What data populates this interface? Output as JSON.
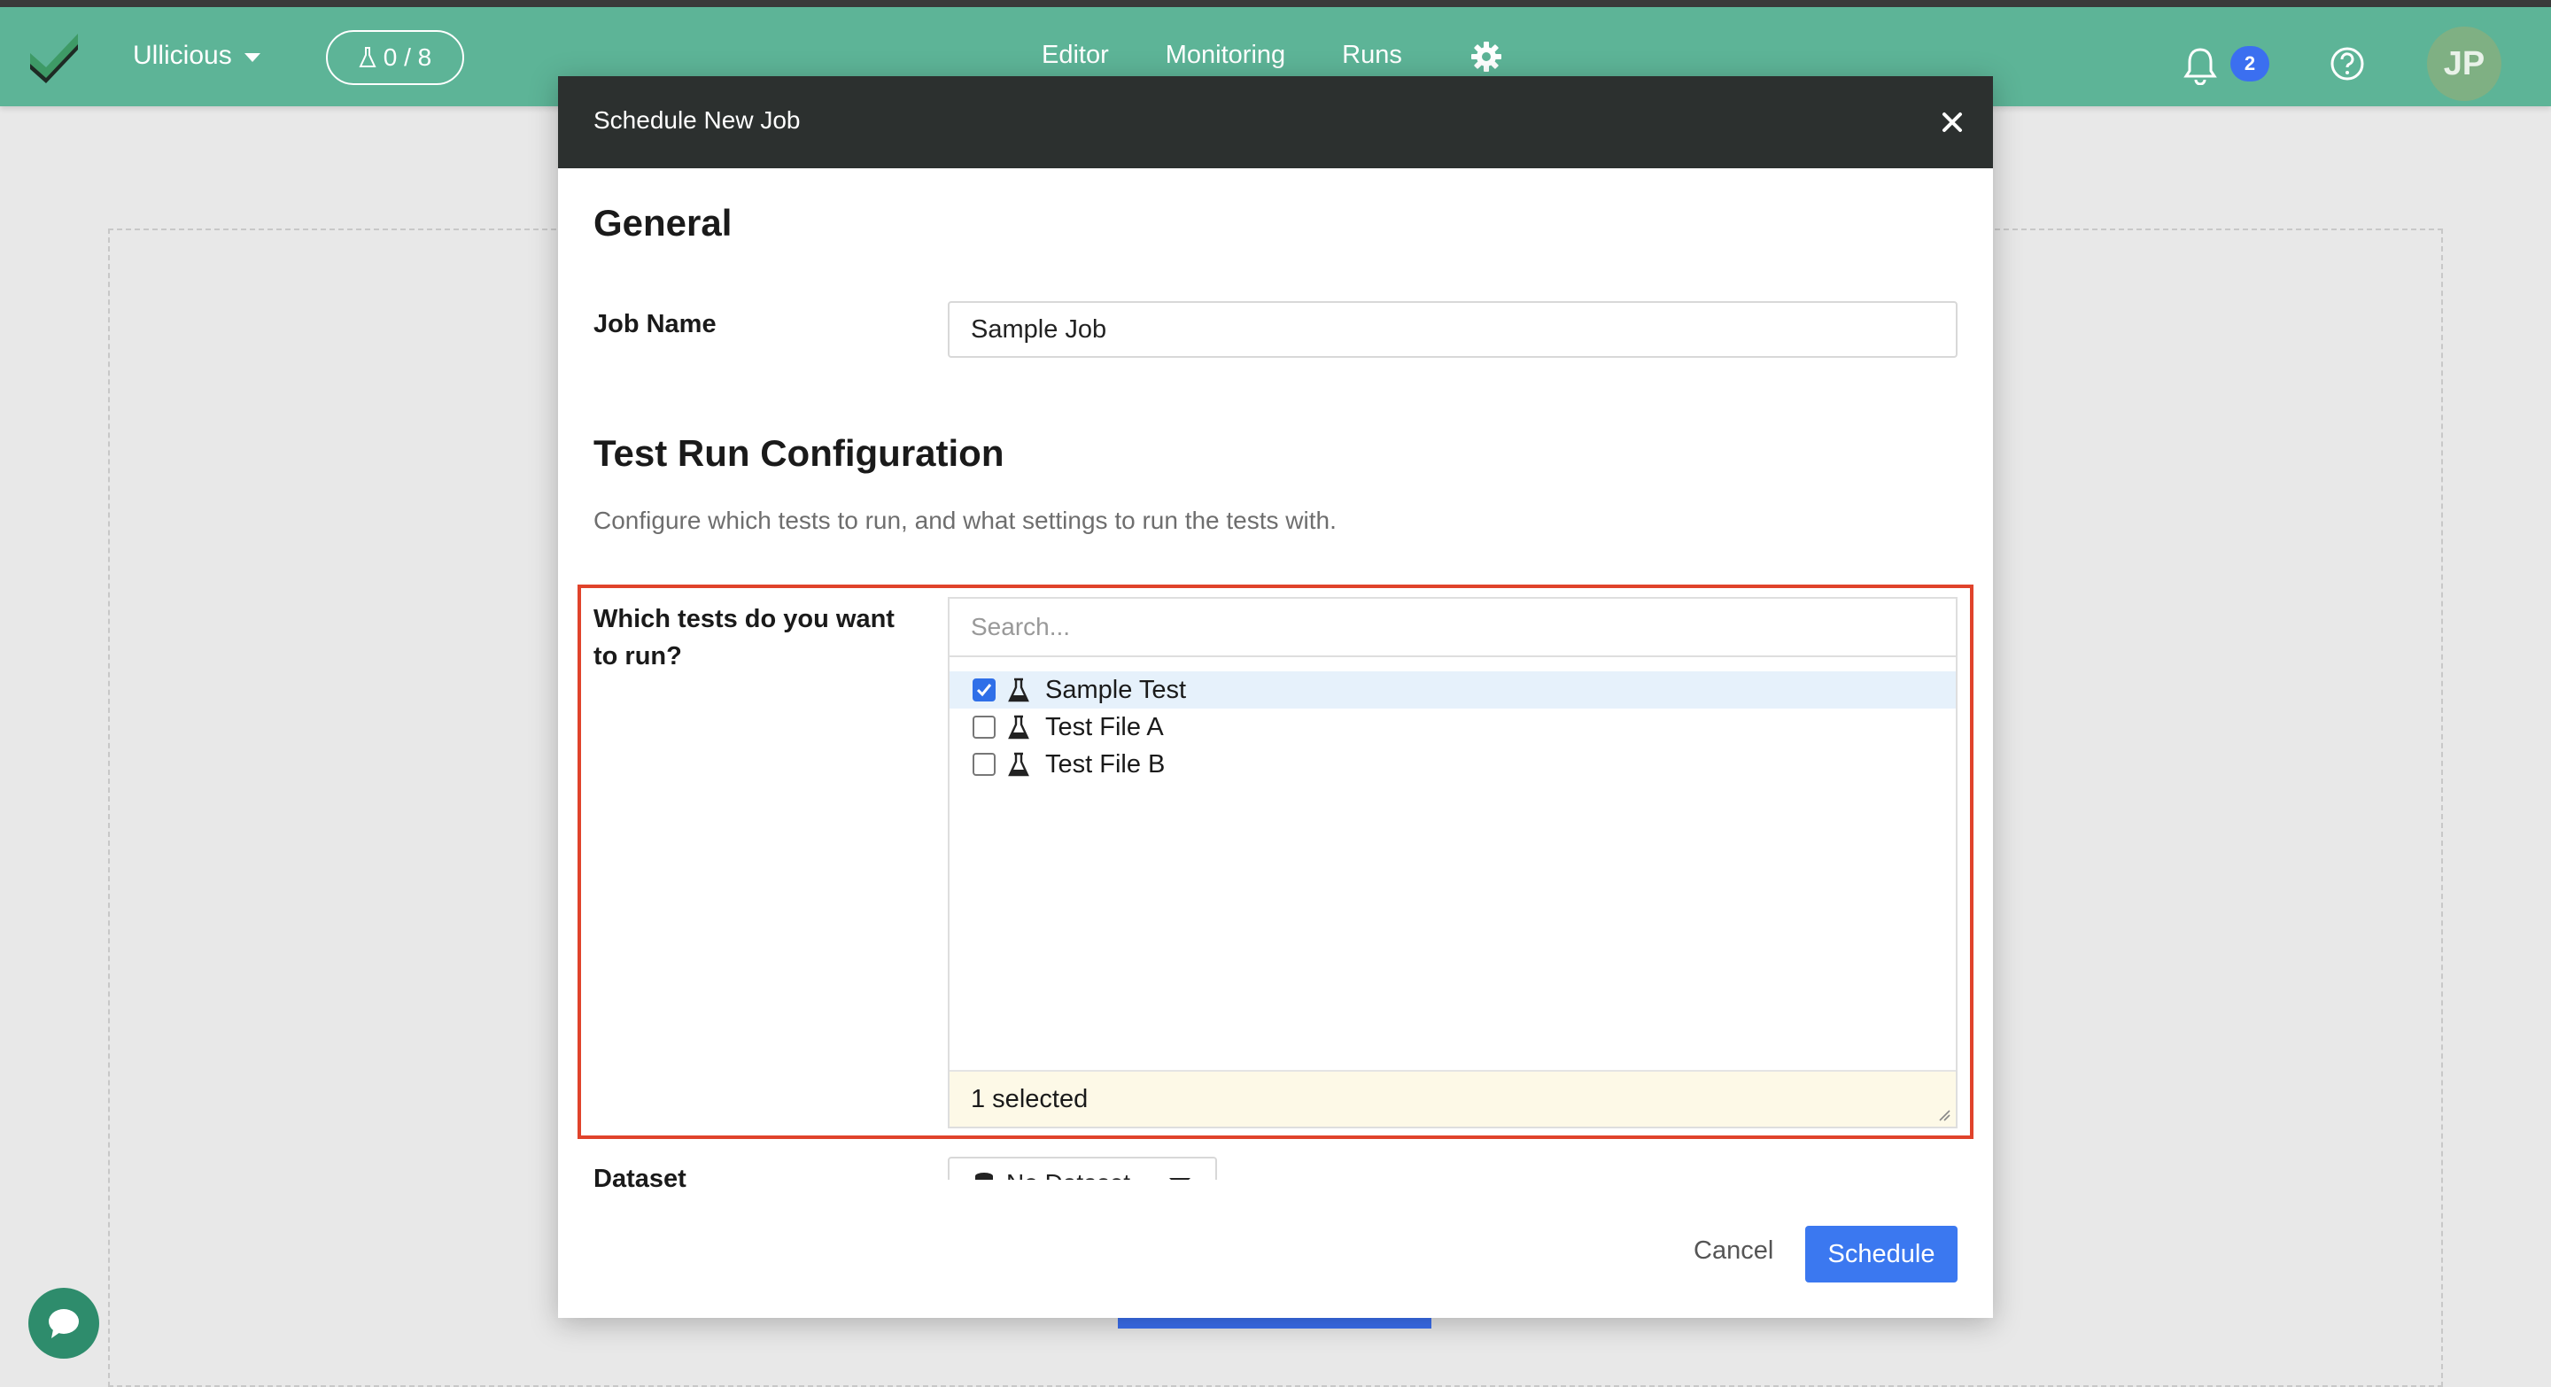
{
  "nav": {
    "project_name": "Ullicious",
    "test_counter": "0 / 8",
    "links": [
      "Editor",
      "Monitoring",
      "Runs"
    ],
    "notification_count": "2",
    "avatar_initials": "JP"
  },
  "modal": {
    "title": "Schedule New Job",
    "general_heading": "General",
    "job_name_label": "Job Name",
    "job_name_value": "Sample Job",
    "config_heading": "Test Run Configuration",
    "config_description": "Configure which tests to run, and what settings to run the tests with.",
    "tests_label": "Which tests do you want to run?",
    "search_placeholder": "Search...",
    "tests": [
      {
        "name": "Sample Test",
        "checked": true
      },
      {
        "name": "Test File A",
        "checked": false
      },
      {
        "name": "Test File B",
        "checked": false
      }
    ],
    "selected_summary": "1 selected",
    "dataset_label": "Dataset",
    "dataset_value": "No Dataset",
    "cancel_label": "Cancel",
    "schedule_label": "Schedule"
  },
  "colors": {
    "navbar": "#5db497",
    "primary": "#3b78f0",
    "highlight_border": "#e0432b",
    "modal_header": "#2c302f"
  }
}
